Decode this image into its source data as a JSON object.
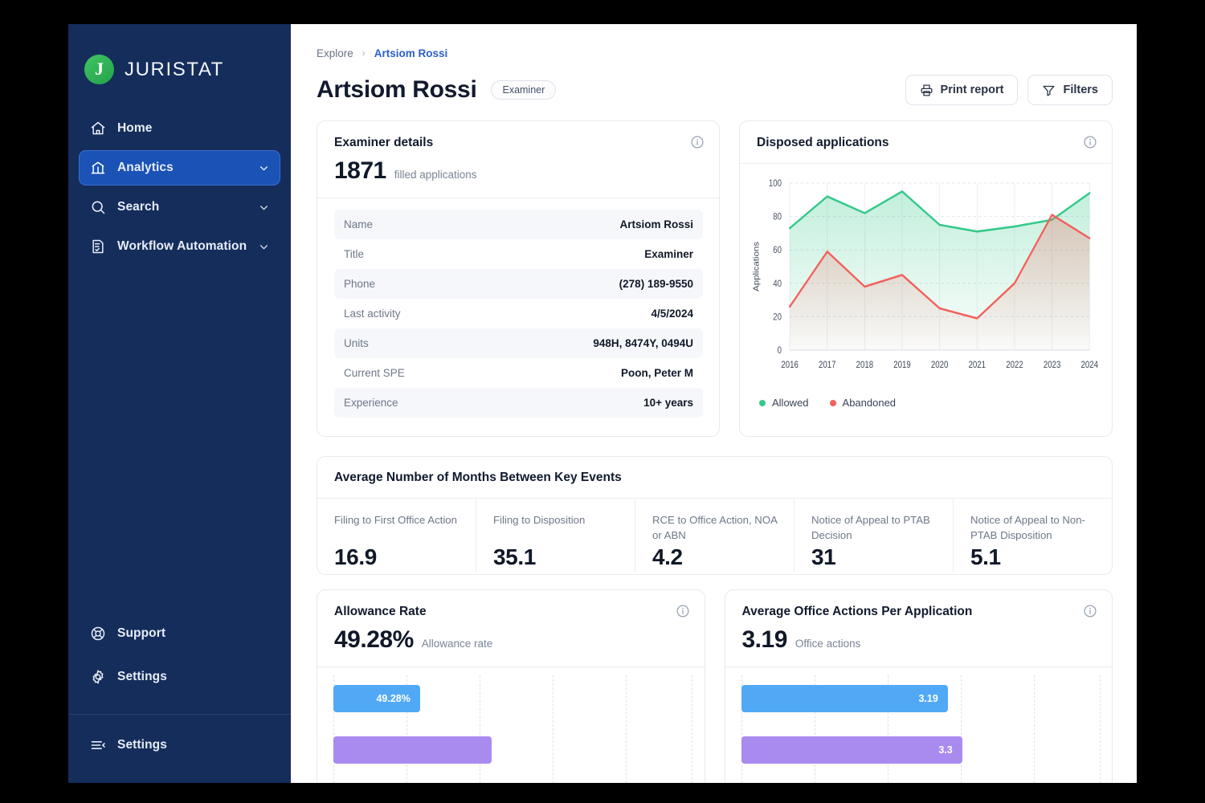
{
  "sidebar": {
    "brand": {
      "name": "JURISTAT",
      "mark": "J"
    },
    "items": [
      {
        "label": "Home",
        "icon": "home-icon",
        "expandable": false,
        "active": false
      },
      {
        "label": "Analytics",
        "icon": "analytics-icon",
        "expandable": true,
        "active": true
      },
      {
        "label": "Search",
        "icon": "search-icon",
        "expandable": true,
        "active": false
      },
      {
        "label": "Workflow Automation",
        "icon": "workflow-icon",
        "expandable": true,
        "active": false
      }
    ],
    "bottom_items": [
      {
        "label": "Support",
        "icon": "lifebuoy-icon"
      },
      {
        "label": "Settings",
        "icon": "gear-icon"
      }
    ],
    "footer_item": {
      "label": "Settings",
      "icon": "collapse-menu-icon"
    }
  },
  "header": {
    "breadcrumb": {
      "parent": "Explore",
      "separator": "›",
      "current": "Artsiom Rossi"
    },
    "title": "Artsiom Rossi",
    "role_chip": "Examiner",
    "print_button": "Print report",
    "filters_button": "Filters"
  },
  "examiner_card": {
    "title": "Examiner details",
    "stat_value": "1871",
    "stat_label": "filled applications",
    "rows": [
      {
        "key": "Name",
        "value": "Artsiom Rossi"
      },
      {
        "key": "Title",
        "value": "Examiner"
      },
      {
        "key": "Phone",
        "value": "(278) 189-9550"
      },
      {
        "key": "Last activity",
        "value": "4/5/2024"
      },
      {
        "key": "Units",
        "value": "948H, 8474Y, 0494U"
      },
      {
        "key": "Current SPE",
        "value": "Poon,  Peter M"
      },
      {
        "key": "Experience",
        "value": "10+ years"
      }
    ]
  },
  "disposed_card": {
    "title": "Disposed applications",
    "legend": [
      {
        "label": "Allowed",
        "color": "#36C98A"
      },
      {
        "label": "Abandoned",
        "color": "#F2615C"
      }
    ]
  },
  "chart_data": {
    "type": "area",
    "title": "Disposed applications",
    "xlabel": "",
    "ylabel": "Applications",
    "x": [
      "2016",
      "2017",
      "2018",
      "2019",
      "2020",
      "2021",
      "2022",
      "2023",
      "2024"
    ],
    "ylim": [
      0,
      100
    ],
    "yticks": [
      0,
      20,
      40,
      60,
      80,
      100
    ],
    "grid": true,
    "legend_position": "bottom-left",
    "series": [
      {
        "name": "Allowed",
        "color": "#36C98A",
        "values": [
          73,
          92,
          82,
          95,
          75,
          71,
          74,
          78,
          94
        ]
      },
      {
        "name": "Abandoned",
        "color": "#F2615C",
        "values": [
          26,
          59,
          38,
          45,
          25,
          19,
          40,
          81,
          67
        ]
      }
    ]
  },
  "key_events_card": {
    "title": "Average Number of Months Between Key Events",
    "items": [
      {
        "label": "Filing to First Office Action",
        "value": "16.9"
      },
      {
        "label": "Filing to Disposition",
        "value": "35.1"
      },
      {
        "label": "RCE to Office Action, NOA or ABN",
        "value": "4.2"
      },
      {
        "label": "Notice of Appeal to PTAB Decision",
        "value": "31"
      },
      {
        "label": "Notice of Appeal to Non-PTAB Disposition",
        "value": "5.1"
      }
    ]
  },
  "allowance_card": {
    "title": "Allowance Rate",
    "stat_value": "49.28%",
    "stat_label": "Allowance rate",
    "bars": [
      {
        "label": "49.28%",
        "width_pct": 24.1,
        "color": "#51A9F6"
      },
      {
        "label": "",
        "width_pct": 44.0,
        "color": "#A98BF0"
      }
    ]
  },
  "office_actions_card": {
    "title": "Average Office Actions Per Application",
    "stat_value": "3.19",
    "stat_label": "Office actions",
    "bars": [
      {
        "label": "3.19",
        "width_pct": 57.5,
        "color": "#51A9F6"
      },
      {
        "label": "3.3",
        "width_pct": 61.5,
        "color": "#A98BF0"
      }
    ]
  }
}
